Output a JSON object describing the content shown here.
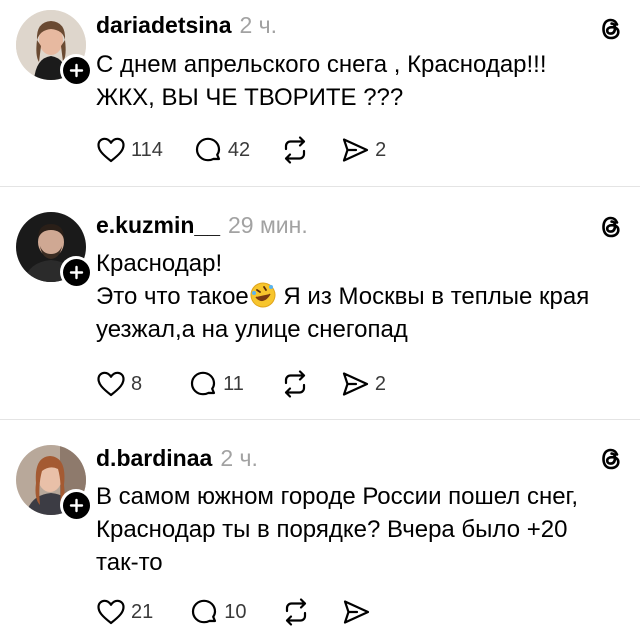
{
  "posts": [
    {
      "username": "dariadetsina",
      "time": "2 ч.",
      "lines": [
        "С днем апрельского снега , Краснодар!!!",
        "ЖКХ, ВЫ ЧЕ ТВОРИТЕ ???"
      ],
      "likes": "114",
      "comments": "42",
      "reposts": "",
      "shares": "2"
    },
    {
      "username": "e.kuzmin__",
      "time": "29 мин.",
      "lines": [
        "Краснодар!",
        "Это что такое",
        " Я из Москвы в теплые края",
        "уезжал,а на улице снегопад"
      ],
      "likes": "8",
      "comments": "11",
      "reposts": "",
      "shares": "2"
    },
    {
      "username": "d.bardinaa",
      "time": "2 ч.",
      "lines": [
        "В самом южном городе России пошел снег,",
        "Краснодар ты в порядке? Вчера было +20",
        "так-то"
      ],
      "likes": "21",
      "comments": "10",
      "reposts": "",
      "shares": ""
    }
  ],
  "icons": {
    "like": "heart-icon",
    "comment": "comment-icon",
    "repost": "repost-icon",
    "share": "share-icon",
    "threads": "threads-logo-icon",
    "follow": "plus-icon",
    "emoji": "rofl-emoji-icon"
  },
  "colors": {
    "text": "#000000",
    "muted": "#a2a2a2",
    "divider": "#e4e4e4"
  }
}
